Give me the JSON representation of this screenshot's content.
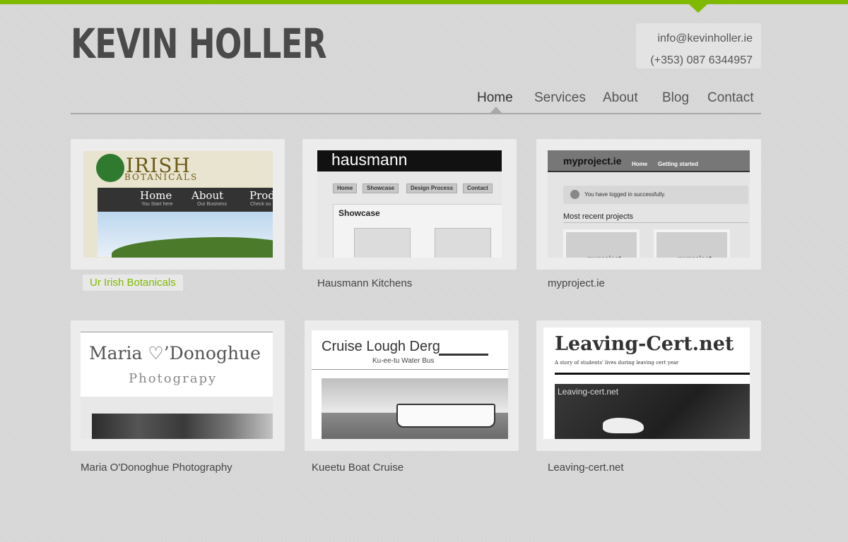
{
  "header": {
    "logo": "KEVIN HOLLER",
    "email": "info@kevinholler.ie",
    "phone": "(+353) 087  6344957",
    "accent_color": "#7fba00"
  },
  "nav": {
    "items": [
      {
        "label": "Home",
        "active": true
      },
      {
        "label": "Services",
        "active": false
      },
      {
        "label": "About",
        "active": false
      },
      {
        "label": "Blog",
        "active": false
      },
      {
        "label": "Contact",
        "active": false
      }
    ]
  },
  "portfolio": {
    "items": [
      {
        "caption": "Ur Irish Botanicals",
        "selected": true,
        "thumb": {
          "brand": "IRISH",
          "brand_sub": "BOTANICALS",
          "nav": [
            {
              "label": "Home",
              "sub": "You Start here"
            },
            {
              "label": "About",
              "sub": "Our Business"
            },
            {
              "label": "Prod",
              "sub": "Check ou"
            }
          ]
        }
      },
      {
        "caption": "Hausmann Kitchens",
        "selected": false,
        "thumb": {
          "title": "hausmann",
          "nav": [
            "Home",
            "Showcase",
            "Design Process",
            "Contact"
          ],
          "section": "Showcase"
        }
      },
      {
        "caption": "myproject.ie",
        "selected": false,
        "thumb": {
          "brand": "myproject.ie",
          "nav": [
            "Home",
            "Getting started"
          ],
          "message": "You have logged in successfully.",
          "section": "Most recent projects",
          "project_label": "myproject"
        }
      },
      {
        "caption": "Maria O'Donoghue Photography",
        "selected": false,
        "thumb": {
          "name": "Maria ♡’Donoghue",
          "tagline": "Photograpy"
        }
      },
      {
        "caption": "Kueetu Boat Cruise",
        "selected": false,
        "thumb": {
          "title": "Cruise Lough Derg",
          "subtitle": "Ku-ee-tu Water Bus"
        }
      },
      {
        "caption": "Leaving-cert.net",
        "selected": false,
        "thumb": {
          "title": "Leaving-Cert.net",
          "subtitle": "A story of students' lives during leaving cert year",
          "photo_label": "Leaving-cert.net"
        }
      }
    ]
  }
}
